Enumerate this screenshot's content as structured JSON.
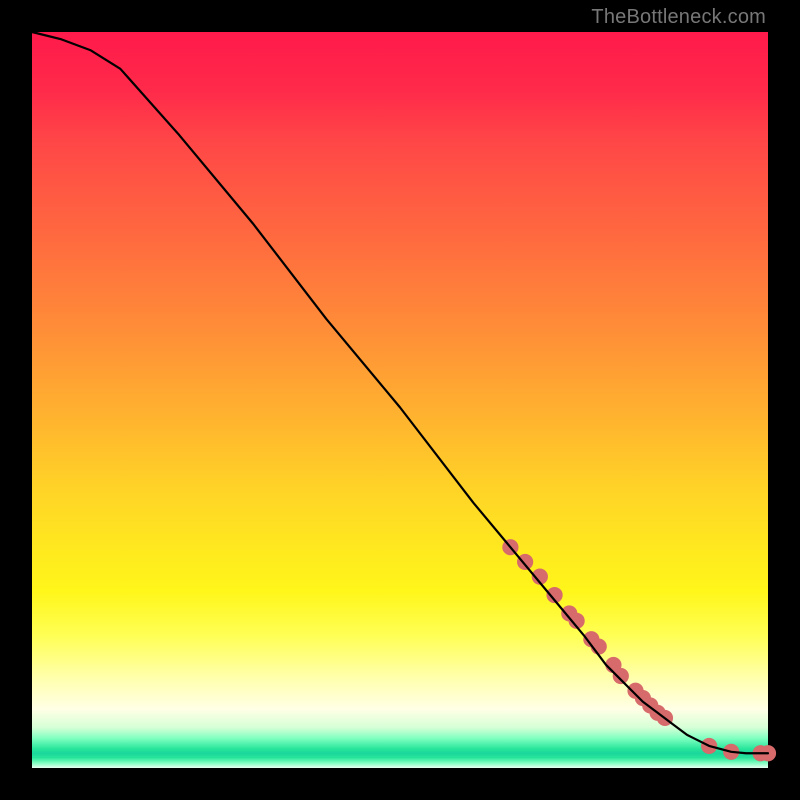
{
  "watermark": {
    "text": "TheBottleneck.com"
  },
  "chart_data": {
    "type": "line",
    "title": "",
    "xlabel": "",
    "ylabel": "",
    "xlim": [
      0,
      100
    ],
    "ylim": [
      0,
      100
    ],
    "grid": false,
    "legend": false,
    "line": {
      "x": [
        0,
        4,
        8,
        12,
        20,
        30,
        40,
        50,
        60,
        65,
        70,
        75,
        78,
        80,
        83,
        85,
        87,
        89,
        90,
        92,
        95,
        97,
        100
      ],
      "y": [
        100,
        99,
        97.5,
        95,
        86,
        74,
        61,
        49,
        36,
        30,
        24,
        18,
        14,
        12,
        9,
        7.5,
        6,
        4.5,
        4,
        3,
        2.2,
        2,
        2
      ]
    },
    "markers": {
      "color": "#d76a6a",
      "radius_pct": 1.1,
      "x": [
        65,
        67,
        69,
        71,
        73,
        74,
        76,
        77,
        79,
        80,
        82,
        83,
        84,
        85,
        86,
        92,
        95,
        99,
        100
      ],
      "y": [
        30,
        28,
        26,
        23.5,
        21,
        20,
        17.5,
        16.5,
        14,
        12.5,
        10.5,
        9.5,
        8.5,
        7.5,
        6.8,
        3,
        2.2,
        2,
        2
      ]
    }
  }
}
